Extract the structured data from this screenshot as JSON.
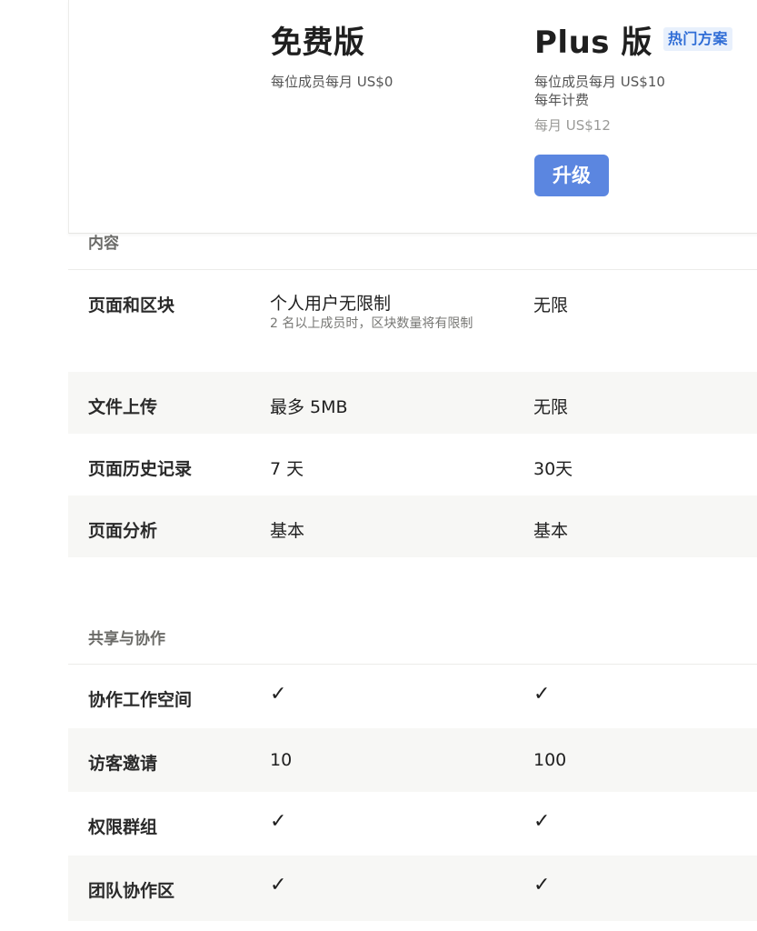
{
  "plans": {
    "free": {
      "name": "免费版",
      "price": "每位成员每月 US$0"
    },
    "plus": {
      "name": "Plus 版",
      "badge": "热门方案",
      "price": "每位成员每月 US$10",
      "billing": "每年计费",
      "monthly": "每月 US$12",
      "upgrade_label": "升级"
    }
  },
  "sections": {
    "content": {
      "title": "内容",
      "rows": [
        {
          "label": "页面和区块",
          "free": "个人用户无限制",
          "free_note": "2 名以上成员时，区块数量将有限制",
          "plus": "无限"
        },
        {
          "label": "文件上传",
          "free": "最多 5MB",
          "plus": "无限"
        },
        {
          "label": "页面历史记录",
          "free": "7 天",
          "plus": "30天"
        },
        {
          "label": "页面分析",
          "free": "基本",
          "plus": "基本"
        }
      ]
    },
    "sharing": {
      "title": "共享与协作",
      "rows": [
        {
          "label": "协作工作空间",
          "free": "✓",
          "plus": "✓"
        },
        {
          "label": "访客邀请",
          "free": "10",
          "plus": "100"
        },
        {
          "label": "权限群组",
          "free": "✓",
          "plus": "✓"
        },
        {
          "label": "团队协作区",
          "free": "✓",
          "plus": "✓"
        }
      ]
    }
  },
  "icons": {
    "check": "check-icon"
  }
}
